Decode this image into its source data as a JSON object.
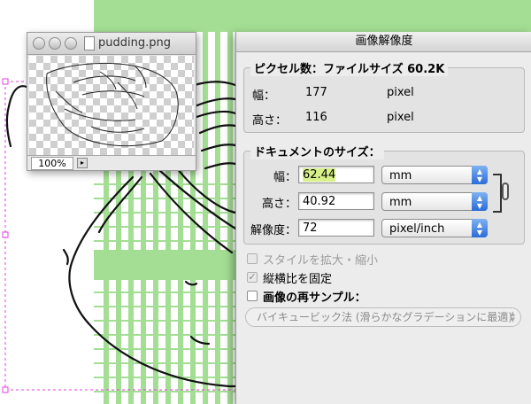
{
  "preview": {
    "filename": "pudding.png",
    "zoom": "100%"
  },
  "dialog": {
    "title": "画像解像度",
    "pixel_group": {
      "title": "ピクセル数：ファイルサイズ 60.2K",
      "width_label": "幅：",
      "width_value": "177",
      "width_unit": "pixel",
      "height_label": "高さ：",
      "height_value": "116",
      "height_unit": "pixel"
    },
    "doc_group": {
      "title": "ドキュメントのサイズ：",
      "width_label": "幅：",
      "width_value": "62.44",
      "width_unit": "mm",
      "height_label": "高さ：",
      "height_value": "40.92",
      "height_unit": "mm",
      "resolution_label": "解像度：",
      "resolution_value": "72",
      "resolution_unit": "pixel/inch"
    },
    "options": {
      "scale_styles_label": "スタイルを拡大・縮小",
      "scale_styles_checked": false,
      "constrain_label": "縦横比を固定",
      "constrain_checked": true,
      "resample_label": "画像の再サンプル：",
      "resample_checked": false,
      "resample_method": "バイキュービック法 (滑らかなグラデーションに最適)"
    }
  },
  "colors": {
    "canvas_green": "#a4de94",
    "guide_magenta": "#e040e0",
    "select_blue": "#2a6bd8",
    "highlight": "#d8f08a"
  }
}
